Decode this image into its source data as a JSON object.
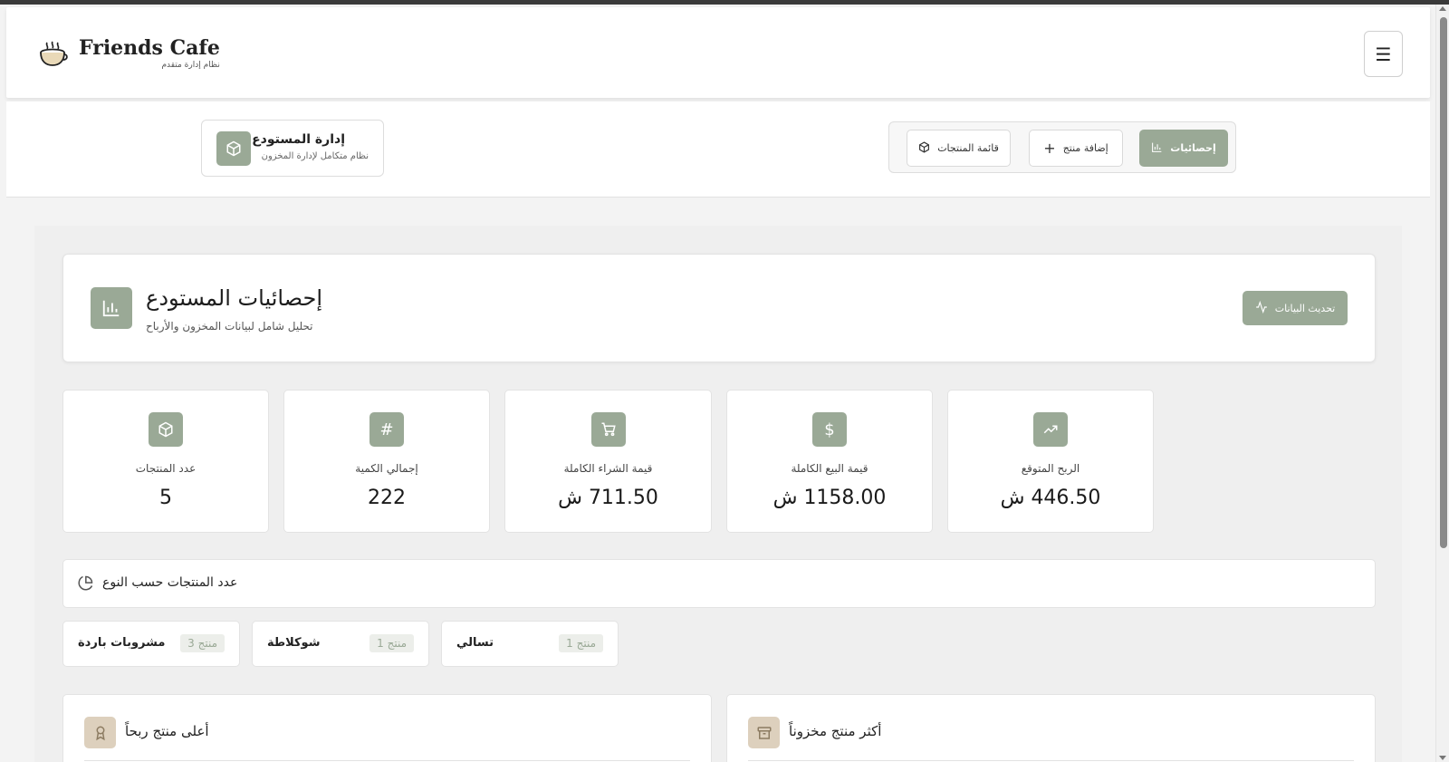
{
  "colors": {
    "accent": "#9aa996",
    "accent_light": "#ddd0bd"
  },
  "header": {
    "brand_name": "Friends Cafe",
    "brand_sub": "نظام إدارة متقدم",
    "icons": {
      "logo": "coffee-cup-icon",
      "menu": "hamburger-icon"
    }
  },
  "warehouse": {
    "title": "إدارة المستودع",
    "subtitle": "نظام متكامل لإدارة المخزون"
  },
  "tabs": [
    {
      "label": "قائمة المنتجات",
      "icon": "box-icon",
      "active": false
    },
    {
      "label": "إضافة منتج",
      "icon": "plus-icon",
      "active": false
    },
    {
      "label": "إحصائيات",
      "icon": "bar-chart-icon",
      "active": true
    }
  ],
  "page": {
    "title": "إحصائيات المستودع",
    "subtitle": "تحليل شامل لبيانات المخزون والأرباح",
    "refresh_label": "تحديث البيانات"
  },
  "stats": [
    {
      "label": "عدد المنتجات",
      "value": "5",
      "icon": "box-icon"
    },
    {
      "label": "إجمالي الكمية",
      "value": "222",
      "icon": "hash-icon"
    },
    {
      "label": "قيمة الشراء الكاملة",
      "value": "711.50 ش",
      "icon": "cart-icon"
    },
    {
      "label": "قيمة البيع الكاملة",
      "value": "1158.00 ش",
      "icon": "dollar-icon"
    },
    {
      "label": "الربح المتوقع",
      "value": "446.50 ش",
      "icon": "trending-up-icon"
    }
  ],
  "types": {
    "title": "عدد المنتجات حسب النوع",
    "items": [
      {
        "name": "مشروبات باردة",
        "count": "منتج 3"
      },
      {
        "name": "شوكلاطة",
        "count": "منتج 1"
      },
      {
        "name": "تسالي",
        "count": "منتج 1"
      }
    ]
  },
  "bottom": {
    "top_profit": "أعلى منتج ربحاً",
    "most_stocked": "أكثر منتج مخزوناً"
  }
}
